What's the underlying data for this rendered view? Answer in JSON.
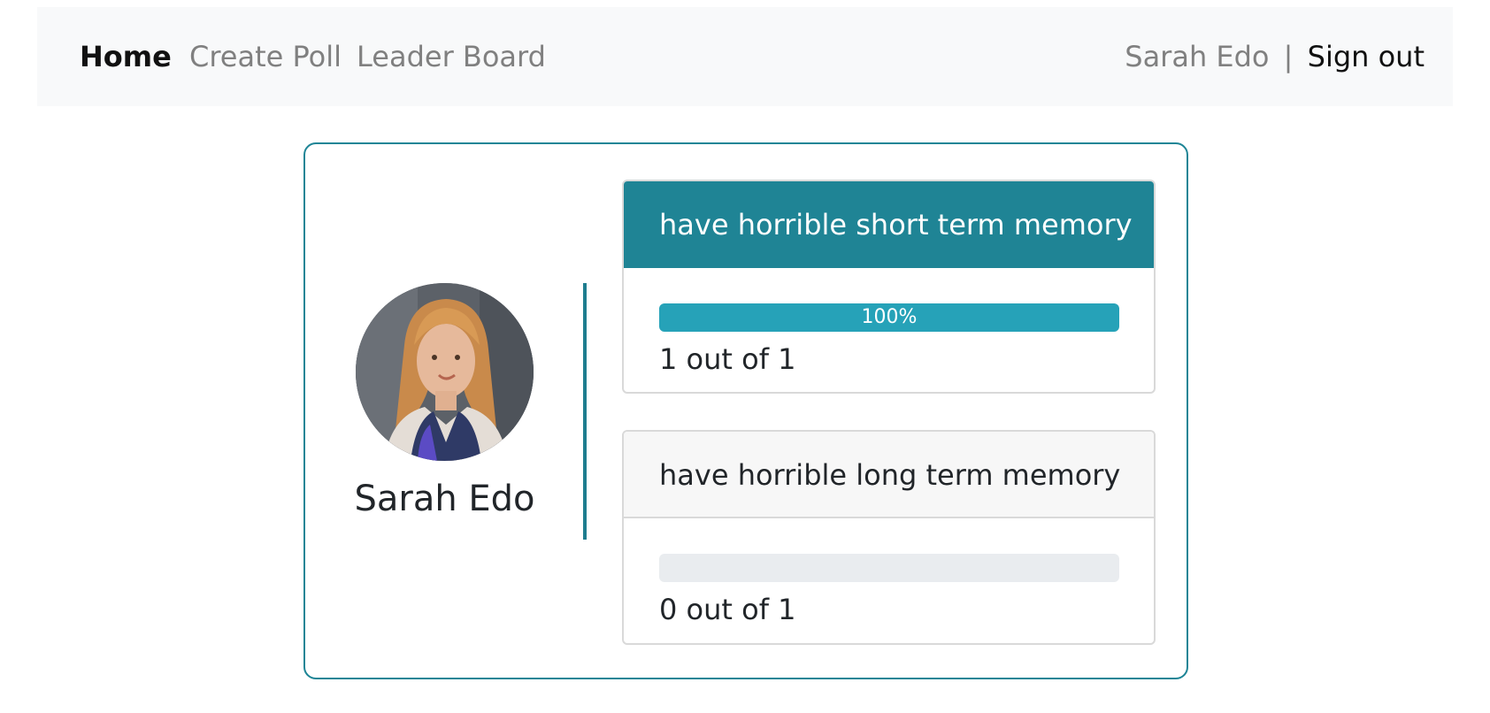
{
  "nav": {
    "home": "Home",
    "create_poll": "Create Poll",
    "leader_board": "Leader Board",
    "user_name": "Sarah Edo",
    "separator": "|",
    "sign_out": "Sign out"
  },
  "poll": {
    "author": "Sarah Edo",
    "accent_color": "#1f8495",
    "options": [
      {
        "text": "have horrible short term memory",
        "percent": 100,
        "percent_label": "100%",
        "votes_label": "1 out of 1",
        "selected": true
      },
      {
        "text": "have horrible long term memory",
        "percent": 0,
        "percent_label": "",
        "votes_label": "0 out of 1",
        "selected": false
      }
    ]
  }
}
